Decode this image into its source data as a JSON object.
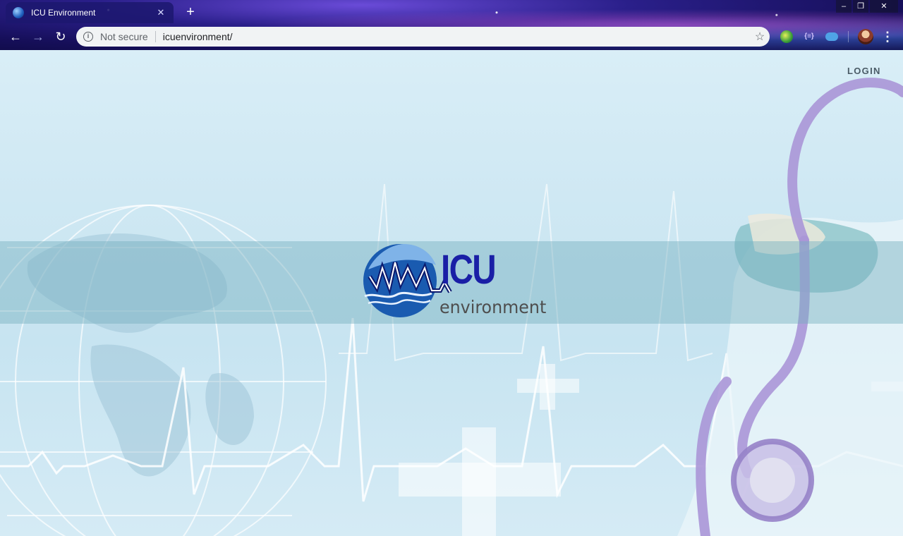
{
  "browser": {
    "tab_title": "ICU Environment",
    "tab_close": "✕",
    "new_tab": "+",
    "security_label": "Not secure",
    "url": "icuenvironment/",
    "window_controls": {
      "minimize": "–",
      "maximize": "❐",
      "close": "✕"
    },
    "nav": {
      "back": "←",
      "forward": "→",
      "reload": "↻"
    },
    "bookmark_icon": "star-icon",
    "extensions": [
      "globe-extension-icon",
      "code-extension-icon",
      "cloud-extension-icon"
    ],
    "menu_icon": "⋮"
  },
  "page": {
    "login_label": "LOGIN",
    "logo": {
      "primary": "ICU",
      "secondary": "environment"
    },
    "colors": {
      "logo_blue": "#1a1fa6",
      "logo_gray": "#4e4e4e",
      "band": "#76afbe"
    }
  }
}
